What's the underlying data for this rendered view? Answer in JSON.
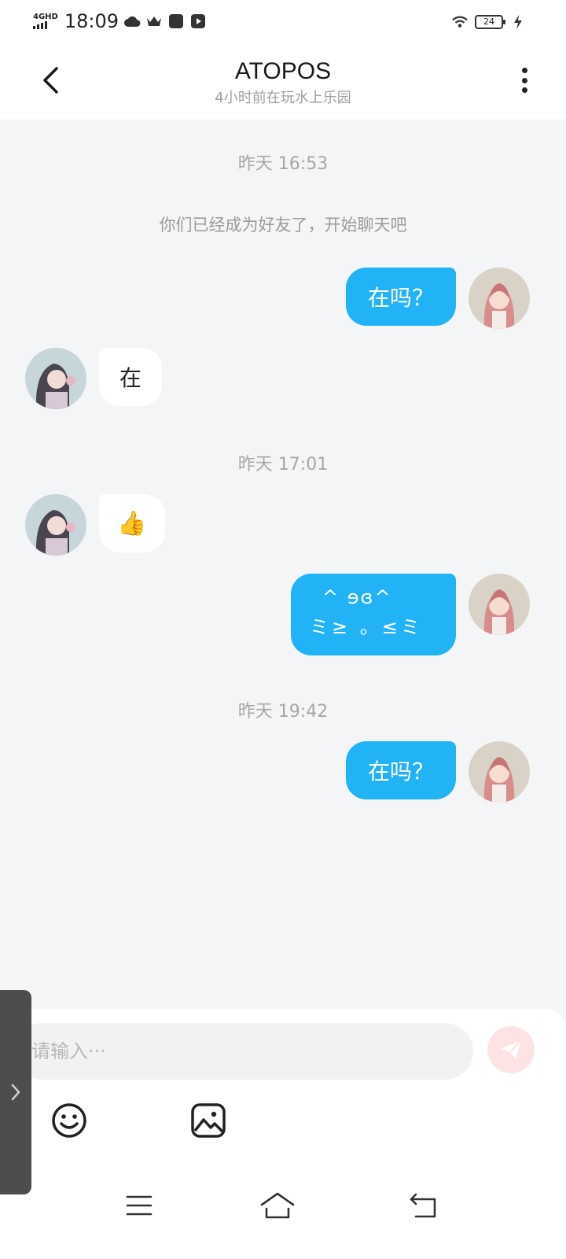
{
  "status_bar": {
    "network": "4GHD",
    "time": "18:09",
    "battery": "24",
    "icons": [
      "weather-icon",
      "crown-icon",
      "app-icon",
      "media-icon",
      "wifi-icon",
      "charging-icon"
    ]
  },
  "header": {
    "back_icon": "chevron-left-icon",
    "title": "ATOPOS",
    "subtitle": "4小时前在玩水上乐园",
    "more_icon": "more-vertical-icon"
  },
  "messages": {
    "ts_1": "昨天 16:53",
    "system_1": "你们已经成为好友了，开始聊天吧",
    "msg_1": "在吗？",
    "msg_2": "在",
    "ts_2": "昨天 17:01",
    "msg_3": "👍",
    "msg_4_line1": "^ ɘɞ^",
    "msg_4_line2": "ミ≥ 。≤ミ",
    "ts_3": "昨天 19:42",
    "msg_5": "在吗？"
  },
  "composer": {
    "placeholder": "请输入···",
    "send_icon": "send-icon",
    "emoji_icon": "emoji-icon",
    "image_icon": "image-icon"
  },
  "colors": {
    "outgoing_bubble": "#21b3f5",
    "incoming_bubble": "#ffffff",
    "background": "#f4f5f7",
    "send_button": "#fde3e3"
  },
  "nav": {
    "menu_icon": "menu-icon",
    "home_icon": "home-icon",
    "back_icon": "back-icon"
  }
}
